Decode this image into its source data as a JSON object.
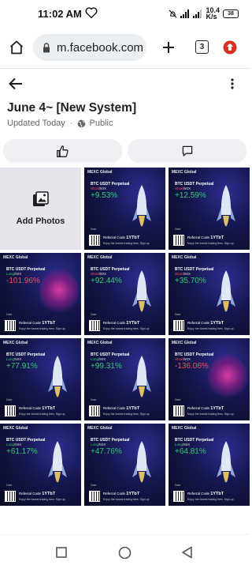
{
  "status": {
    "time": "11:02 AM",
    "net_speed": "10.4\nK/s",
    "battery": "38"
  },
  "browser": {
    "url": "m.facebook.com",
    "tab_count": "3"
  },
  "album": {
    "title": "June 4~ [New System]",
    "updated": "Updated Today",
    "privacy": "Public"
  },
  "grid": {
    "add_photos_label": "Add Photos",
    "tiles": [
      {
        "pct": "+9.53%",
        "side": "Short/50X",
        "neg": false
      },
      {
        "pct": "+12.59%",
        "side": "Short/50X",
        "neg": false
      },
      {
        "pct": "-101.96%",
        "side": "Long/50X",
        "neg": true
      },
      {
        "pct": "+92.44%",
        "side": "Short/50X",
        "neg": false
      },
      {
        "pct": "+35.70%",
        "side": "Short/50X",
        "neg": false
      },
      {
        "pct": "+77.91%",
        "side": "Long/50X",
        "neg": false
      },
      {
        "pct": "+99.31%",
        "side": "Long/50X",
        "neg": false
      },
      {
        "pct": "-136.06%",
        "side": "Short/50X",
        "neg": true
      },
      {
        "pct": "+61.17%",
        "side": "Long/50X",
        "neg": false
      },
      {
        "pct": "+47.76%",
        "side": "Long/50X",
        "neg": false
      },
      {
        "pct": "+64.81%",
        "side": "Long/50X",
        "neg": false
      }
    ],
    "brand": "MEXC Global",
    "pair": "BTC USDT Perpetual",
    "ref_label": "Referral Code",
    "ref_code": "1YTbT",
    "enjoy": "Enjoy the lowest trading fees. Sign up",
    "date_label": "Date"
  },
  "colors": {
    "positive": "#2ecc71",
    "negative": "#ff4d5b",
    "fb_blue": "#1877f2"
  }
}
